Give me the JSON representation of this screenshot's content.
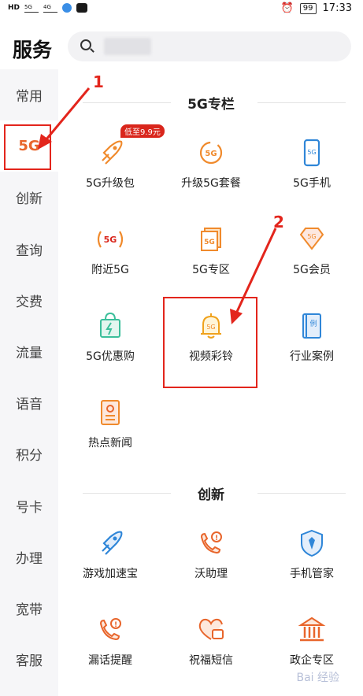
{
  "status_bar": {
    "left_icons": [
      "HD",
      "5G",
      "4G"
    ],
    "alarm_icon": "alarm-icon",
    "battery": "99",
    "time": "17:33"
  },
  "header": {
    "title": "服务",
    "search_placeholder": ""
  },
  "sidebar": {
    "items": [
      {
        "label": "常用"
      },
      {
        "label": "5G"
      },
      {
        "label": "创新"
      },
      {
        "label": "查询"
      },
      {
        "label": "交费"
      },
      {
        "label": "流量"
      },
      {
        "label": "语音"
      },
      {
        "label": "积分"
      },
      {
        "label": "号卡"
      },
      {
        "label": "办理"
      },
      {
        "label": "宽带"
      },
      {
        "label": "客服"
      }
    ],
    "active_index": 1
  },
  "sections": [
    {
      "title": "5G专栏",
      "items": [
        {
          "label": "5G升级包",
          "icon": "rocket-icon",
          "badge": "低至9.9元"
        },
        {
          "label": "升级5G套餐",
          "icon": "5g-upgrade-icon"
        },
        {
          "label": "5G手机",
          "icon": "phone-icon"
        },
        {
          "label": "附近5G",
          "icon": "signal-icon"
        },
        {
          "label": "5G专区",
          "icon": "zone-icon"
        },
        {
          "label": "5G会员",
          "icon": "diamond-icon"
        },
        {
          "label": "5G优惠购",
          "icon": "shopping-bag-icon"
        },
        {
          "label": "视频彩铃",
          "icon": "bell-icon"
        },
        {
          "label": "行业案例",
          "icon": "book-icon"
        },
        {
          "label": "热点新闻",
          "icon": "news-icon"
        }
      ]
    },
    {
      "title": "创新",
      "items": [
        {
          "label": "游戏加速宝",
          "icon": "rocket-icon"
        },
        {
          "label": "沃助理",
          "icon": "phone-alert-icon"
        },
        {
          "label": "手机管家",
          "icon": "shield-icon"
        },
        {
          "label": "漏话提醒",
          "icon": "missed-call-icon"
        },
        {
          "label": "祝福短信",
          "icon": "heart-sms-icon"
        },
        {
          "label": "政企专区",
          "icon": "building-icon"
        }
      ]
    }
  ],
  "annotations": {
    "step1": "1",
    "step2": "2"
  },
  "watermark": "Bai 经验",
  "colors": {
    "accent": "#e8652b",
    "orange_icon": "#f08a2c",
    "blue_icon": "#2f86d8",
    "green_icon": "#3cbf9b",
    "annotation": "#e3251c",
    "badge": "#d9261c"
  }
}
